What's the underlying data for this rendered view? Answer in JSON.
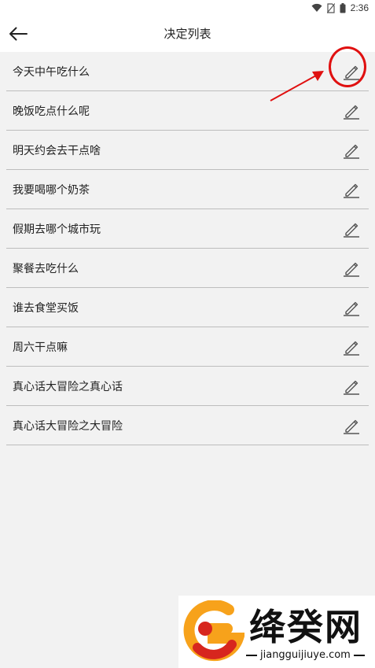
{
  "status_bar": {
    "time": "2:36",
    "icons": [
      "wifi-icon",
      "no-sim-icon",
      "battery-icon"
    ]
  },
  "app_bar": {
    "back_icon": "arrow-left-icon",
    "title": "决定列表"
  },
  "list": {
    "edit_icon": "pencil-icon",
    "items": [
      {
        "label": "今天中午吃什么"
      },
      {
        "label": "晚饭吃点什么呢"
      },
      {
        "label": "明天约会去干点啥"
      },
      {
        "label": "我要喝哪个奶茶"
      },
      {
        "label": "假期去哪个城市玩"
      },
      {
        "label": "聚餐去吃什么"
      },
      {
        "label": "谁去食堂买饭"
      },
      {
        "label": "周六干点嘛"
      },
      {
        "label": "真心话大冒险之真心话"
      },
      {
        "label": "真心话大冒险之大冒险"
      }
    ]
  },
  "annotation": {
    "color": "#e01010"
  },
  "watermark": {
    "brand": "绛癸网",
    "url": "jiangguijiuye.com",
    "logo_colors": [
      "#f7a21b",
      "#d7261e"
    ]
  }
}
